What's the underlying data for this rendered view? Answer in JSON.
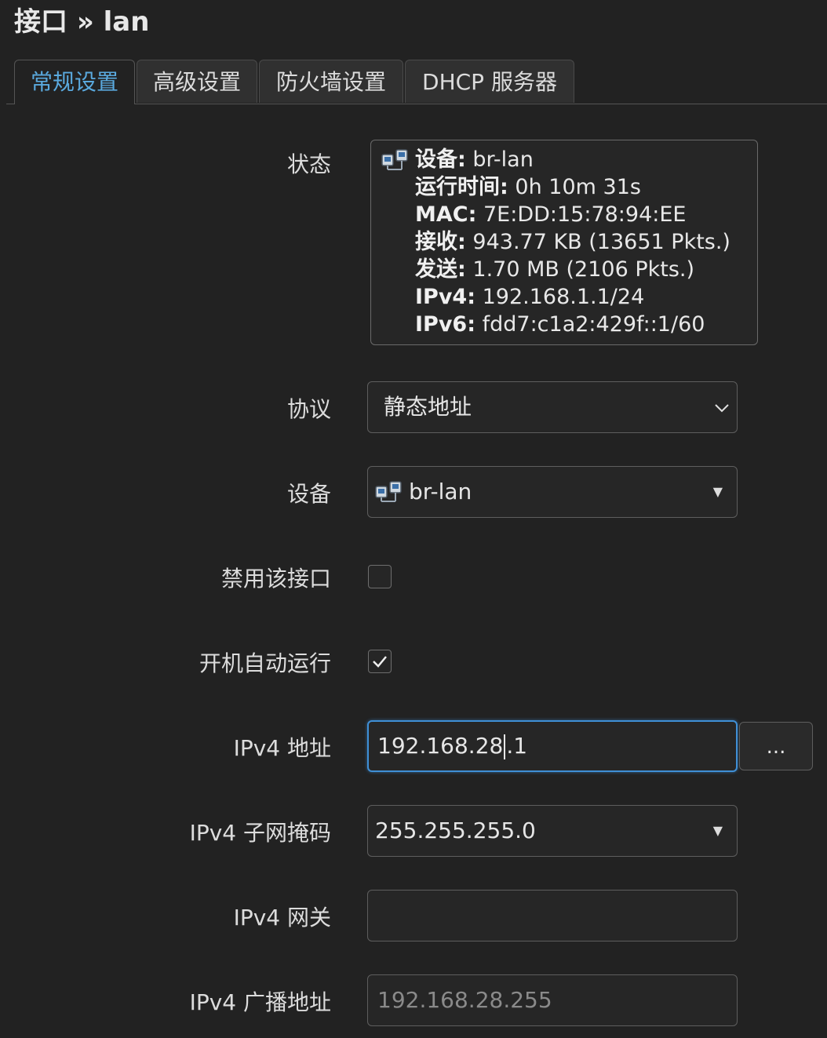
{
  "header": {
    "title": "接口 » lan"
  },
  "tabs": [
    {
      "label": "常规设置",
      "active": true
    },
    {
      "label": "高级设置",
      "active": false
    },
    {
      "label": "防火墙设置",
      "active": false
    },
    {
      "label": "DHCP 服务器",
      "active": false
    }
  ],
  "status": {
    "label": "状态",
    "icon": "bridge-device-icon",
    "lines": [
      {
        "key": "设备:",
        "value": "br-lan"
      },
      {
        "key": "运行时间:",
        "value": "0h 10m 31s"
      },
      {
        "key": "MAC:",
        "value": "7E:DD:15:78:94:EE"
      },
      {
        "key": "接收:",
        "value": "943.77 KB (13651 Pkts.)"
      },
      {
        "key": "发送:",
        "value": "1.70 MB (2106 Pkts.)"
      },
      {
        "key": "IPv4:",
        "value": "192.168.1.1/24"
      },
      {
        "key": "IPv6:",
        "value": "fdd7:c1a2:429f::1/60"
      }
    ]
  },
  "protocol": {
    "label": "协议",
    "value": "静态地址"
  },
  "device": {
    "label": "设备",
    "value": "br-lan",
    "icon": "bridge-device-icon"
  },
  "disable": {
    "label": "禁用该接口",
    "checked": false
  },
  "autostart": {
    "label": "开机自动运行",
    "checked": true
  },
  "ipv4_address": {
    "label": "IPv4 地址",
    "value_before_caret": "192.168.28",
    "value_after_caret": ".1",
    "more_label": "..."
  },
  "ipv4_netmask": {
    "label": "IPv4 子网掩码",
    "value": "255.255.255.0"
  },
  "ipv4_gateway": {
    "label": "IPv4 网关",
    "value": ""
  },
  "ipv4_broadcast": {
    "label": "IPv4 广播地址",
    "placeholder": "192.168.28.255"
  },
  "colors": {
    "background": "#222222",
    "accent": "#5aa9de",
    "focus_border": "#3f8fd6"
  }
}
